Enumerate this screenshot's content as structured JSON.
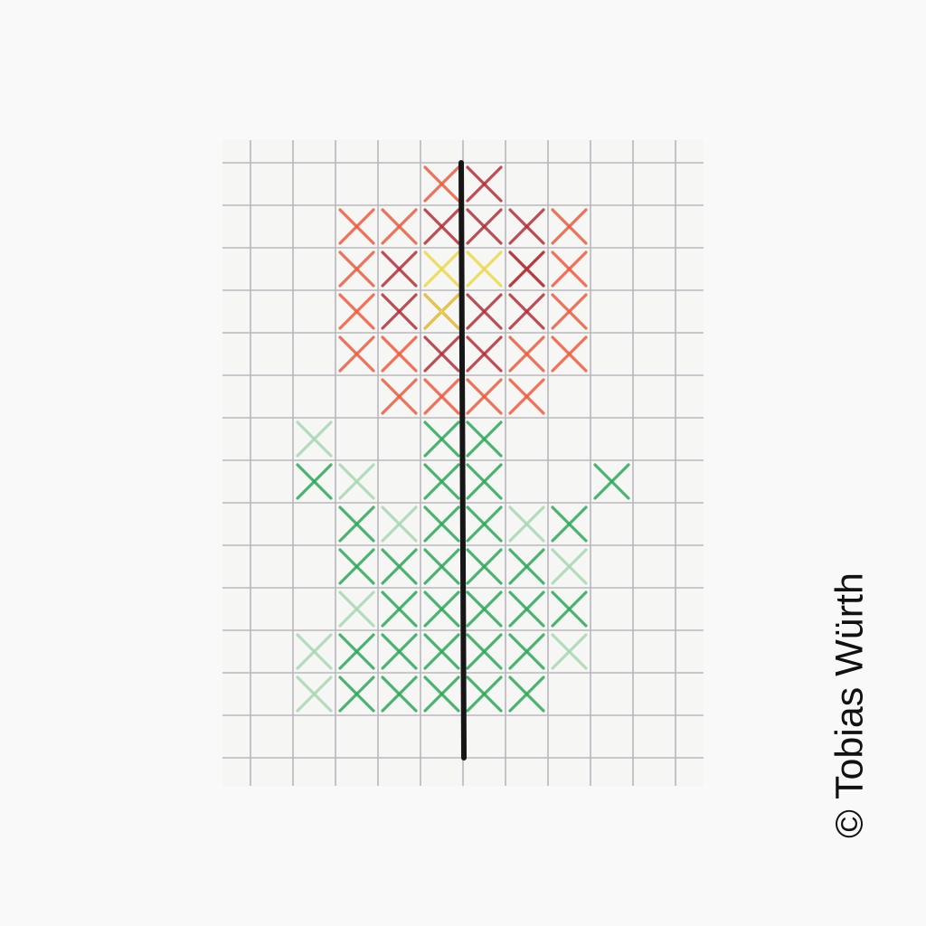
{
  "credit": {
    "text": "© Tobias Würth"
  },
  "pattern": {
    "rows": 15,
    "cols": 11,
    "colors": {
      "background": "#f9f9f9",
      "paper": "#f6f6f4",
      "grid_line": "#b8b8bc",
      "center_line": "#161616",
      "petal_orange": "#f05a3c",
      "petal_dark_red": "#b52f3a",
      "flower_center_yellow": "#ecd94a",
      "leaf_green": "#2ea85a",
      "leaf_pale_green": "#a8d8b4"
    },
    "stitches": [
      {
        "color": "petal_orange",
        "cells": [
          [
            1,
            5
          ],
          [
            2,
            3
          ],
          [
            2,
            4
          ],
          [
            3,
            3
          ],
          [
            4,
            3
          ],
          [
            5,
            3
          ],
          [
            5,
            4
          ],
          [
            6,
            4
          ],
          [
            6,
            5
          ],
          [
            2,
            8
          ],
          [
            3,
            8
          ],
          [
            4,
            8
          ],
          [
            5,
            8
          ],
          [
            6,
            6
          ],
          [
            6,
            7
          ],
          [
            3,
            7
          ],
          [
            5,
            7
          ]
        ]
      },
      {
        "color": "petal_dark_red",
        "cells": [
          [
            1,
            6
          ],
          [
            2,
            5
          ],
          [
            2,
            6
          ],
          [
            2,
            7
          ],
          [
            3,
            4
          ],
          [
            4,
            4
          ],
          [
            3,
            7
          ],
          [
            4,
            7
          ],
          [
            5,
            5
          ],
          [
            5,
            6
          ],
          [
            4,
            5
          ],
          [
            4,
            6
          ]
        ]
      },
      {
        "color": "flower_center_yellow",
        "cells": [
          [
            3,
            5
          ],
          [
            3,
            6
          ],
          [
            4,
            5
          ]
        ]
      },
      {
        "color": "leaf_green",
        "cells": [
          [
            7,
            5
          ],
          [
            7,
            6
          ],
          [
            8,
            5
          ],
          [
            8,
            6
          ],
          [
            9,
            5
          ],
          [
            9,
            6
          ],
          [
            10,
            4
          ],
          [
            10,
            5
          ],
          [
            10,
            6
          ],
          [
            11,
            4
          ],
          [
            11,
            5
          ],
          [
            11,
            6
          ],
          [
            12,
            4
          ],
          [
            12,
            5
          ],
          [
            12,
            6
          ],
          [
            13,
            4
          ],
          [
            13,
            5
          ],
          [
            13,
            6
          ],
          [
            8,
            2
          ],
          [
            9,
            3
          ],
          [
            10,
            3
          ],
          [
            12,
            3
          ],
          [
            13,
            3
          ],
          [
            8,
            9
          ],
          [
            9,
            8
          ],
          [
            10,
            7
          ],
          [
            11,
            7
          ],
          [
            12,
            7
          ],
          [
            13,
            7
          ],
          [
            11,
            8
          ]
        ]
      },
      {
        "color": "leaf_pale_green",
        "cells": [
          [
            8,
            3
          ],
          [
            9,
            4
          ],
          [
            10,
            8
          ],
          [
            12,
            2
          ],
          [
            7,
            2
          ],
          [
            11,
            3
          ],
          [
            9,
            7
          ],
          [
            12,
            8
          ],
          [
            13,
            2
          ]
        ]
      }
    ]
  }
}
